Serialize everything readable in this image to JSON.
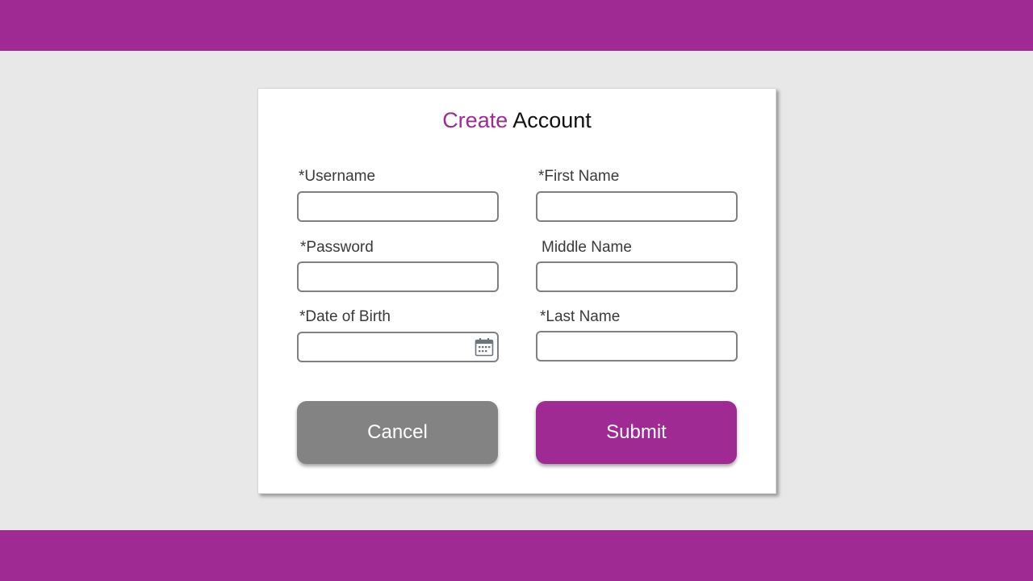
{
  "form": {
    "title_accent": "Create",
    "title_rest": " Account",
    "fields": {
      "username": {
        "label": "*Username",
        "value": "",
        "placeholder": ""
      },
      "password": {
        "label": "*Password",
        "value": "",
        "placeholder": ""
      },
      "dob": {
        "label": "*Date of Birth",
        "value": "",
        "placeholder": ""
      },
      "first_name": {
        "label": "*First Name",
        "value": "",
        "placeholder": ""
      },
      "middle_name": {
        "label": "Middle Name",
        "value": "",
        "placeholder": ""
      },
      "last_name": {
        "label": "*Last Name",
        "value": "",
        "placeholder": ""
      }
    },
    "cancel_label": "Cancel",
    "submit_label": "Submit"
  },
  "icons": {
    "date_picker": "calendar-icon"
  },
  "colors": {
    "brand": "#a02a93",
    "background": "#e8e8e8",
    "cancel_button": "#838383",
    "field_border": "#808080"
  }
}
